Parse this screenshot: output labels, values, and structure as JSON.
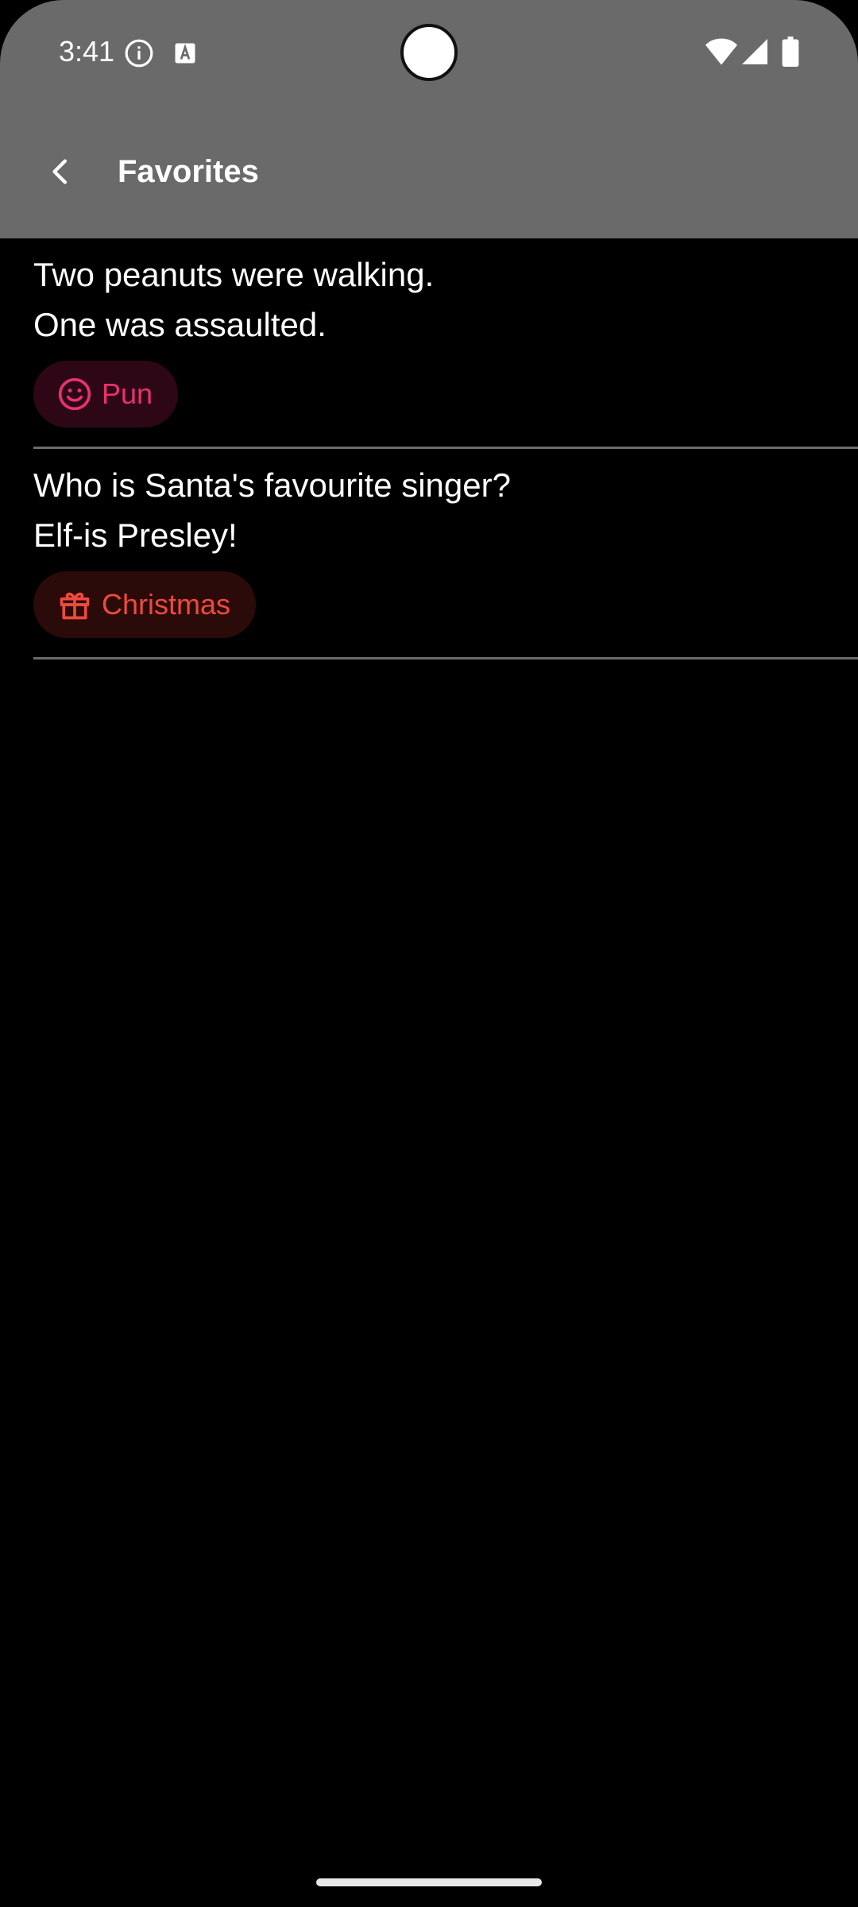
{
  "status_bar": {
    "time": "3:41"
  },
  "app_bar": {
    "title": "Favorites"
  },
  "jokes": [
    {
      "text": "Two peanuts were walking.\nOne was assaulted.",
      "category": "Pun",
      "category_icon": "smiley-icon",
      "category_color": "#e8326e"
    },
    {
      "text": "Who is Santa's favourite singer?\nElf-is Presley!",
      "category": "Christmas",
      "category_icon": "gift-icon",
      "category_color": "#ee4a3e"
    }
  ],
  "colors": {
    "header_bg": "#6a6a6a",
    "background": "#000000",
    "divider": "#6b6b6b"
  }
}
